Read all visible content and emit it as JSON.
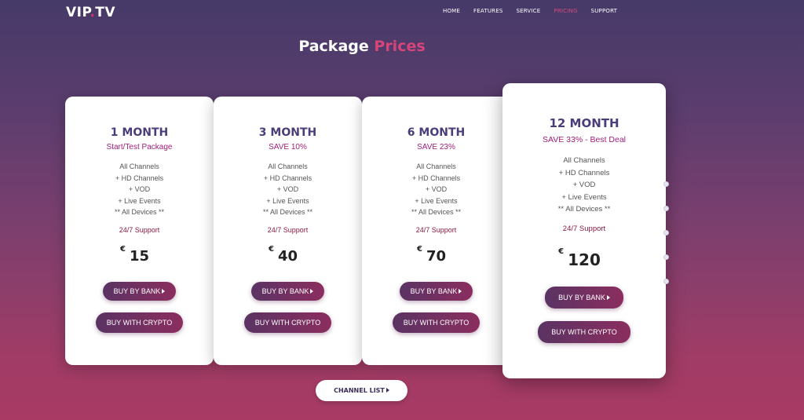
{
  "brand": {
    "name_part1": "VIP",
    "name_part2": "TV"
  },
  "nav": [
    "HOME",
    "FEATURES",
    "SERVICE",
    "PRICING",
    "SUPPORT"
  ],
  "header": {
    "title_part1": "Package",
    "title_part2": "Prices"
  },
  "plans": [
    {
      "name": "1 MONTH",
      "subtitle": "Start/Test Package",
      "features": [
        "All Channels",
        "+ HD Channels",
        "+ VOD",
        "+ Live Events",
        "** All Devices **"
      ],
      "support": "24/7 Support",
      "currency": "€",
      "price": "15",
      "bank_label": "BUY BY BANK",
      "crypto_label": "BUY WITH CRYPTO"
    },
    {
      "name": "3 MONTH",
      "subtitle": "SAVE 10%",
      "features": [
        "All Channels",
        "+ HD Channels",
        "+ VOD",
        "+ Live Events",
        "** All Devices **"
      ],
      "support": "24/7 Support",
      "currency": "€",
      "price": "40",
      "bank_label": "BUY BY BANK",
      "crypto_label": "BUY WITH CRYPTO"
    },
    {
      "name": "6 MONTH",
      "subtitle": "SAVE 23%",
      "features": [
        "All Channels",
        "+ HD Channels",
        "+ VOD",
        "+ Live Events",
        "** All Devices **"
      ],
      "support": "24/7 Support",
      "currency": "€",
      "price": "70",
      "bank_label": "BUY BY BANK",
      "crypto_label": "BUY WITH CRYPTO"
    },
    {
      "name": "12 MONTH",
      "subtitle": "SAVE 33% - Best Deal",
      "features": [
        "All Channels",
        "+ HD Channels",
        "+ VOD",
        "+ Live Events",
        "** All Devices **"
      ],
      "support": "24/7 Support",
      "currency": "€",
      "price": "120",
      "bank_label": "BUY BY BANK",
      "crypto_label": "BUY WITH CRYPTO"
    }
  ],
  "channel_list_label": "CHANNEL LIST",
  "colors": {
    "accent": "#d6457a",
    "plan_name": "#4b3d79",
    "subtitle": "#a0207a",
    "support": "#8a1a3e"
  }
}
